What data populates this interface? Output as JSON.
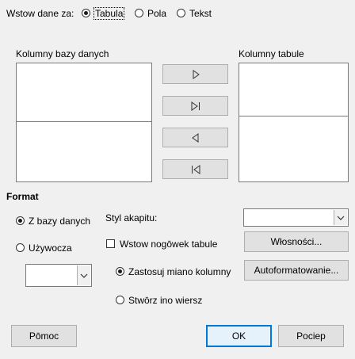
{
  "insert_data_as": {
    "label": "Wstow dane za:",
    "options": [
      {
        "label": "Tabula",
        "checked": true
      },
      {
        "label": "Pola",
        "checked": false
      },
      {
        "label": "Tekst",
        "checked": false
      }
    ]
  },
  "database_columns": {
    "label": "Kolumny bazy danych"
  },
  "table_columns": {
    "label": "Kolumny tabule"
  },
  "arrow_buttons": [
    "move-right",
    "move-all-right",
    "move-left",
    "move-all-left"
  ],
  "format": {
    "title": "Format",
    "from_database": {
      "label": "Z bazy danych",
      "checked": true
    },
    "user_defined": {
      "label": "Używocza",
      "checked": false
    },
    "paragraph_style_label": "Styl akapitu:",
    "insert_table_heading": {
      "label": "Wstow nogōwek tabule",
      "checked": false
    },
    "apply_column_name": {
      "label": "Zastosuj miano kolumny",
      "checked": true
    },
    "create_row_only": {
      "label": "Stwōrz ino wiersz",
      "checked": false
    },
    "properties_button": "Włosności...",
    "autoformat_button": "Autoformatowanie..."
  },
  "buttons": {
    "help": "Pōmoc",
    "ok": "OK",
    "cancel": "Pociep"
  }
}
